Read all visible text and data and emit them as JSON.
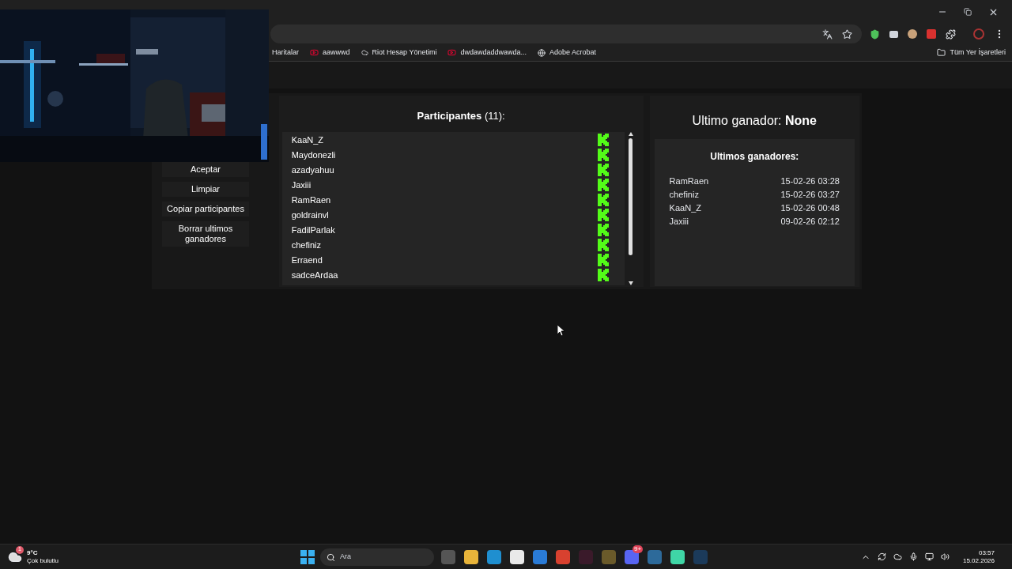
{
  "browser": {
    "bookmarks": [
      "Haritalar",
      "aawwwd",
      "Riot Hesap Yönetimi",
      "dwdawdaddwawda...",
      "Adobe Acrobat"
    ],
    "all_bookmarks": "Tüm Yer İşaretleri"
  },
  "buttons": [
    "Aceptar",
    "Limpiar",
    "Copiar participantes",
    "Borrar ultimos ganadores"
  ],
  "participants": {
    "title": "**Participantes** (11):",
    "items": [
      "KaaN_Z",
      "Maydonezli",
      "azadyahuu",
      "Jaxiii",
      "RamRaen",
      "goldrainvl",
      "FadilParlak",
      "chefiniz",
      "Erraend",
      "sadceArdaa"
    ]
  },
  "last_winner": "Ultimo ganador: **None**",
  "winners": {
    "title": "Ultimos ganadores:",
    "items": [
      {
        "name": "RamRaen",
        "time": "15-02-26 03:28"
      },
      {
        "name": "chefiniz",
        "time": "15-02-26 03:27"
      },
      {
        "name": "KaaN_Z",
        "time": "15-02-26 00:48"
      },
      {
        "name": "Jaxiii",
        "time": "09-02-26 02:12"
      }
    ]
  },
  "taskbar": {
    "temperature": "9°C",
    "weather": "Çok bulutlu",
    "weather_badge": "1",
    "search_placeholder": "Ara",
    "chat_badge": "9+",
    "time": "03:57",
    "date": "15.02.2026"
  }
}
